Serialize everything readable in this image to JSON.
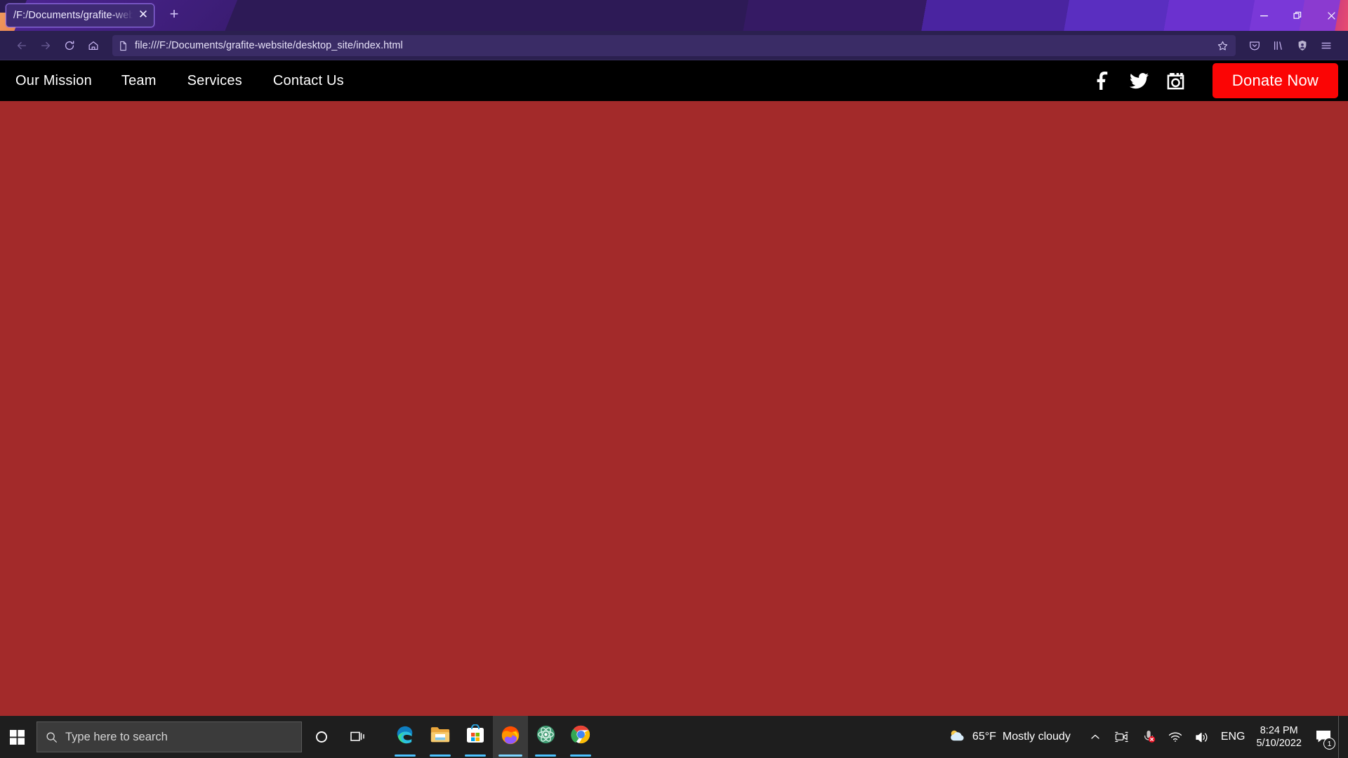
{
  "browser": {
    "tab": {
      "title": "/F:/Documents/grafite-website/desktop_site/index.html",
      "close_label": "✕"
    },
    "new_tab_label": "+",
    "window_controls": {
      "minimize": "minimize-button",
      "restore": "restore-button",
      "close": "close-button"
    },
    "toolbar": {
      "back": "back-button",
      "forward": "forward-button",
      "reload": "reload-button",
      "home": "home-button",
      "url": "file:///F:/Documents/grafite-website/desktop_site/index.html",
      "bookmark": "bookmark-star-icon",
      "pocket": "pocket-icon",
      "library": "library-icon",
      "account": "account-shield-icon",
      "menu": "hamburger-menu-icon"
    }
  },
  "site": {
    "nav_links": [
      {
        "label": "Our Mission"
      },
      {
        "label": "Team"
      },
      {
        "label": "Services"
      },
      {
        "label": "Contact Us"
      }
    ],
    "social": [
      {
        "name": "facebook-icon"
      },
      {
        "name": "twitter-icon"
      },
      {
        "name": "instagram-icon"
      }
    ],
    "donate_label": "Donate Now",
    "colors": {
      "navbar_bg": "#000000",
      "body_bg": "#a32a2a",
      "donate_bg": "#fb0505",
      "nav_text": "#ffffff"
    }
  },
  "taskbar": {
    "search_placeholder": "Type here to search",
    "cortana": "cortana-icon",
    "task_view": "task-view-icon",
    "apps": [
      {
        "name": "microsoft-edge"
      },
      {
        "name": "file-explorer"
      },
      {
        "name": "microsoft-store"
      },
      {
        "name": "firefox"
      },
      {
        "name": "atom"
      },
      {
        "name": "google-chrome"
      }
    ],
    "weather": {
      "temperature": "65°F",
      "description": "Mostly cloudy"
    },
    "tray": {
      "chevron": "show-hidden-icons",
      "meet_now": "meet-now-icon",
      "microphone_muted": "microphone-muted-icon",
      "network": "wifi-icon",
      "volume": "volume-icon",
      "language": "ENG"
    },
    "clock": {
      "time": "8:24 PM",
      "date": "5/10/2022"
    },
    "notification_count": "1"
  }
}
